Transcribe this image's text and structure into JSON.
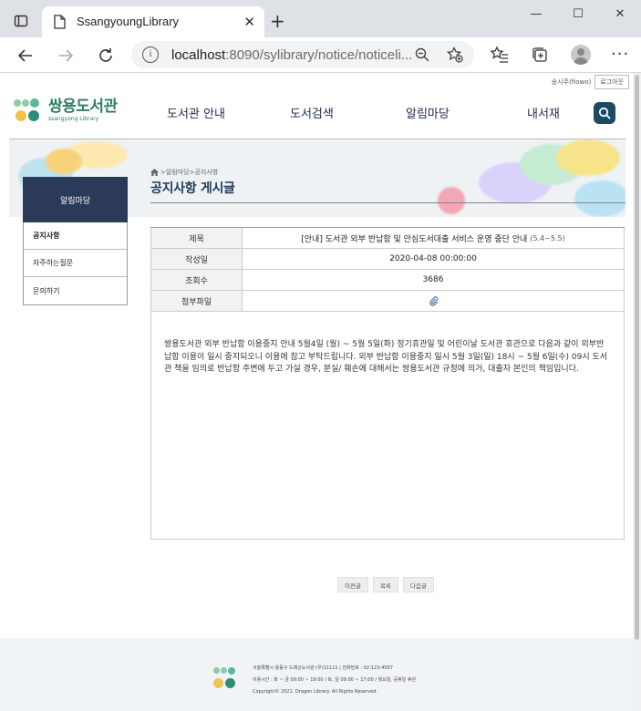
{
  "browser": {
    "tab_title": "SsangyoungLibrary",
    "url_host": "localhost",
    "url_path": ":8090/sylibrary/notice/noticeli..."
  },
  "header": {
    "user_name": "송시주(fiowo)",
    "logout_label": "로그아웃",
    "brand_main": "쌍용도서관",
    "brand_sub": "ssangyong Library",
    "nav": [
      "도서관 안내",
      "도서검색",
      "알림마당",
      "내서재"
    ]
  },
  "sidebar": {
    "title": "알림마당",
    "items": [
      "공지사항",
      "자주하는질문",
      "문의하기"
    ]
  },
  "breadcrumb": {
    "path": ">알림마당>공지사항"
  },
  "page_title": "공지사항 게시글",
  "post": {
    "subject_label": "제목",
    "subject": "[안내] 도서관 외부 반납함 및 안심도서대출 서비스 운영 중단 안내",
    "subject_period": "(5.4~5.5)",
    "date_label": "작성일",
    "date": "2020-04-08 00:00:00",
    "views_label": "조회수",
    "views": "3686",
    "attach_label": "첨부파일",
    "body": "쌍용도서관 외부 반납함 이용중지 안내 5월4일 (월) ~ 5월 5일(화) 정기휴관일 및 어린이날 도서관 휴관으로 다음과 같이 외부반납함 이용이 일시 중지되오니 이용에 참고 부탁드립니다. 외부 반납함 이용중지 일시 5월 3일(일) 18시 ~ 5월 6일(수) 09시 도서관 책을 임의로 반납함 주변에 두고 가실 경우, 분실/ 훼손에 대해서는 쌍용도서관 규정에 의거, 대출자 본인의 책임입니다."
  },
  "buttons": {
    "prev": "이전글",
    "list": "목록",
    "next": "다음글"
  },
  "footer": {
    "line1": "서울특별시 용동구 드래곤도서관 (우)11111 | 전화번호 : 02-123-4567",
    "line2": "이용시간 : 화 ~ 금 09:00 ~ 19:00 / 토, 일 09:00 ~ 17:00 / 월요일, 공휴일 휴관",
    "line3": "Copyright© 2021. Dragon Library. All Rights Reserved."
  },
  "colors": {
    "brand": "#2e7d67",
    "navy": "#2c3a5a",
    "search_button": "#1b4a66"
  }
}
